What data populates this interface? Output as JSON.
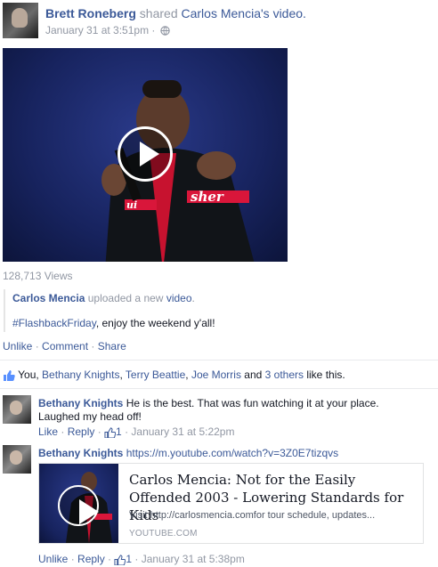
{
  "post": {
    "author": "Brett Roneberg",
    "verb": "shared",
    "target_owner": "Carlos Mencia",
    "target_suffix": "'s",
    "target_type": "video.",
    "timestamp": "January 31 at 3:51pm",
    "separator": "·"
  },
  "video": {
    "views": "128,713 Views"
  },
  "original": {
    "author": "Carlos Mencia",
    "action": "uploaded a new",
    "object": "video",
    "period": ".",
    "hashtag": "#FlashbackFriday",
    "caption_rest": ", enjoy the weekend y'all!"
  },
  "actions": {
    "unlike": "Unlike",
    "comment": "Comment",
    "share": "Share",
    "sep": " · "
  },
  "likes": {
    "prefix": "You, ",
    "people": [
      "Bethany Knights",
      "Terry Beattie",
      "Joe Morris"
    ],
    "and": " and ",
    "others": "3 others",
    "suffix": " like this."
  },
  "comments": [
    {
      "author": "Bethany Knights",
      "text_line1": "He is the best. That was fun watching it at your place.",
      "text_line2": "Laughed my head off!",
      "like": "Like",
      "reply": "Reply",
      "like_count": "1",
      "timestamp": "January 31 at 5:22pm"
    },
    {
      "author": "Bethany Knights",
      "url": "https://m.youtube.com/watch?v=3Z0E7tizqvs",
      "unlike": "Unlike",
      "reply": "Reply",
      "like_count": "1",
      "timestamp": "January 31 at 5:38pm"
    }
  ],
  "preview": {
    "title": "Carlos Mencia: Not for the Easily Offended 2003 - Lowering Standards for Kids",
    "description": "Visit http://carlosmencia.comfor tour schedule, updates...",
    "domain": "YOUTUBE.COM"
  },
  "colors": {
    "link": "#3b5998",
    "muted": "#9197a3",
    "video_bg": "#17235e"
  }
}
